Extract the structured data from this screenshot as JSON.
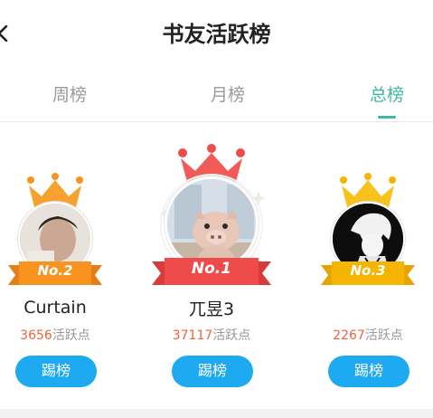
{
  "header": {
    "title": "书友活跃榜"
  },
  "tabs": [
    {
      "label": "周榜",
      "active": false
    },
    {
      "label": "月榜",
      "active": false
    },
    {
      "label": "总榜",
      "active": true
    }
  ],
  "ranks": [
    {
      "badge": "No.2",
      "name": "Curtain",
      "points": "3656",
      "points_suffix": "活跃点",
      "button": "踢榜",
      "badge_color": "#f7931e",
      "avatar": "user-photo-avatar"
    },
    {
      "badge": "No.1",
      "name": "兀昱3",
      "points": "37117",
      "points_suffix": "活跃点",
      "button": "踢榜",
      "badge_color": "#f04b4b",
      "avatar": "pig-figurine-avatar"
    },
    {
      "badge": "No.3",
      "name": "",
      "points": "2267",
      "points_suffix": "活跃点",
      "button": "踢榜",
      "badge_color": "#f5b400",
      "avatar": "anime-character-avatar"
    }
  ],
  "colors": {
    "accent": "#3db8a4",
    "button": "#1eaaf1",
    "points": "#f0643c"
  }
}
